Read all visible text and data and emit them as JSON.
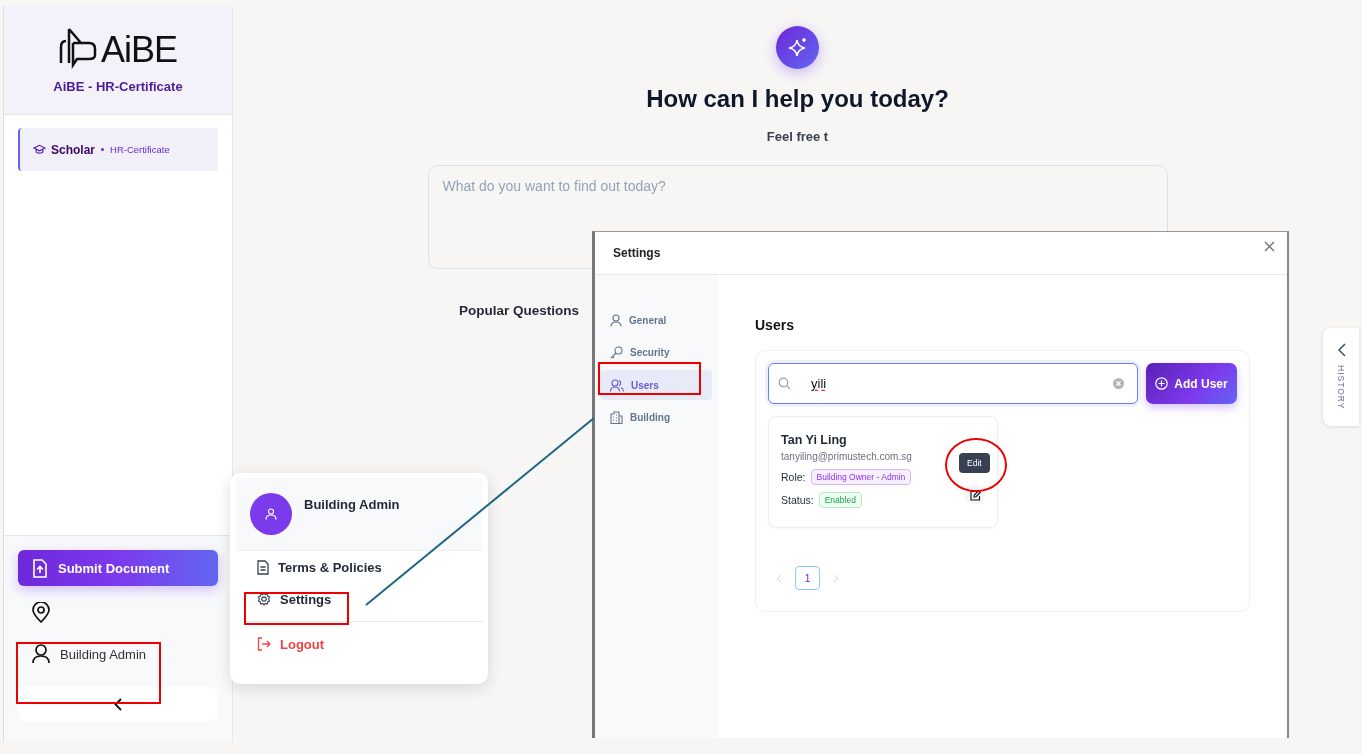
{
  "sidebar": {
    "logo_text": "AiBE",
    "subtitle": "AiBE - HR-Certificate",
    "items": [
      {
        "label": "Scholar",
        "sublabel": "HR-Certificate",
        "selected": true
      }
    ],
    "submit_button": "Submit Document",
    "user": "Building Admin"
  },
  "main": {
    "heading": "How can I help you today?",
    "subheading": "Feel free t",
    "prompt": {
      "placeholder": "What do you want to find out today?"
    },
    "popular_title": "Popular Questions"
  },
  "user_menu": {
    "name": "Building Admin",
    "items": [
      {
        "label": "Terms & Policies",
        "kind": "terms"
      },
      {
        "label": "Settings",
        "kind": "settings"
      },
      {
        "label": "Logout",
        "kind": "logout"
      }
    ]
  },
  "settings": {
    "title": "Settings",
    "nav": [
      {
        "label": "General",
        "kind": "general",
        "selected": false
      },
      {
        "label": "Security",
        "kind": "security",
        "selected": false
      },
      {
        "label": "Users",
        "kind": "users",
        "selected": true
      },
      {
        "label": "Building",
        "kind": "building",
        "selected": false
      }
    ],
    "section_title": "Users",
    "search": {
      "value": "yili"
    },
    "add_button": "Add User",
    "users": [
      {
        "name": "Tan Yi Ling",
        "email": "tanyiling@primustech.com.sg",
        "role_label": "Role:",
        "role": "Building Owner - Admin",
        "status_label": "Status:",
        "status": "Enabled",
        "tooltip": "Edit"
      }
    ],
    "pages": [
      {
        "label": "1",
        "selected": true
      }
    ]
  },
  "history_tab": "HISTORY"
}
